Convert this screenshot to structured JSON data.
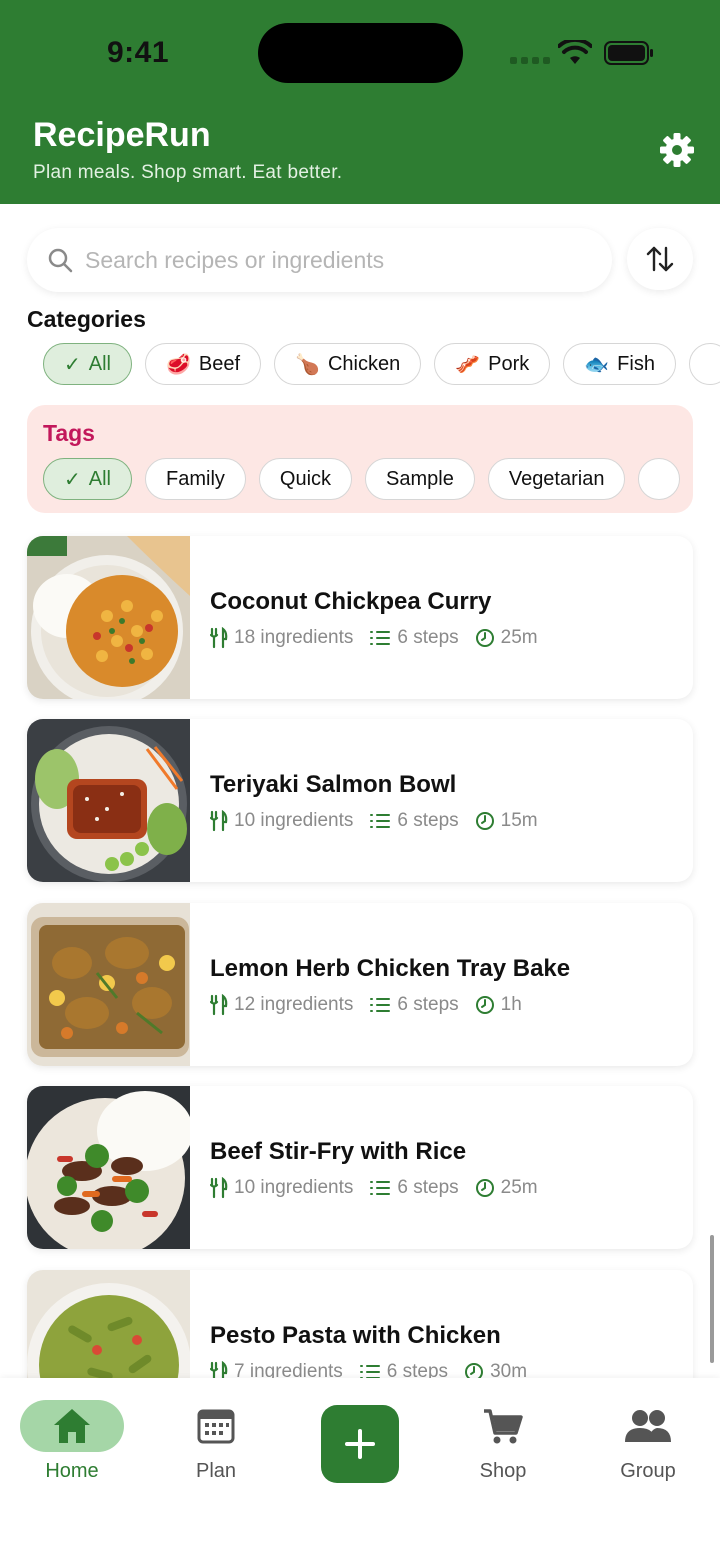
{
  "status_bar": {
    "time": "9:41"
  },
  "header": {
    "title": "RecipeRun",
    "subtitle": "Plan meals. Shop smart. Eat better.",
    "settings_icon": "gear-icon",
    "bg_color": "#2e7d32"
  },
  "search": {
    "placeholder": "Search recipes or ingredients",
    "value": ""
  },
  "categories": {
    "title": "Categories",
    "items": [
      {
        "label": "All",
        "emoji": "",
        "active": true
      },
      {
        "label": "Beef",
        "emoji": "🥩"
      },
      {
        "label": "Chicken",
        "emoji": "🍗"
      },
      {
        "label": "Pork",
        "emoji": "🥓"
      },
      {
        "label": "Fish",
        "emoji": "🐟"
      }
    ]
  },
  "tags": {
    "title": "Tags",
    "items": [
      {
        "label": "All",
        "active": true
      },
      {
        "label": "Family"
      },
      {
        "label": "Quick"
      },
      {
        "label": "Sample"
      },
      {
        "label": "Vegetarian"
      }
    ]
  },
  "recipes": [
    {
      "name": "Coconut Chickpea Curry",
      "ingredients": "18 ingredients",
      "steps": "6 steps",
      "time": "25m"
    },
    {
      "name": "Teriyaki Salmon Bowl",
      "ingredients": "10 ingredients",
      "steps": "6 steps",
      "time": "15m"
    },
    {
      "name": "Lemon Herb Chicken Tray Bake",
      "ingredients": "12 ingredients",
      "steps": "6 steps",
      "time": "1h"
    },
    {
      "name": "Beef Stir-Fry with Rice",
      "ingredients": "10 ingredients",
      "steps": "6 steps",
      "time": "25m"
    },
    {
      "name": "Pesto Pasta with Chicken",
      "ingredients": "7 ingredients",
      "steps": "6 steps",
      "time": "30m"
    }
  ],
  "tabbar": {
    "items": [
      {
        "label": "Home",
        "icon": "home-icon",
        "active": true
      },
      {
        "label": "Plan",
        "icon": "calendar-icon"
      },
      {
        "label": "",
        "icon": "plus-icon"
      },
      {
        "label": "Shop",
        "icon": "cart-icon"
      },
      {
        "label": "Group",
        "icon": "group-icon"
      }
    ]
  },
  "colors": {
    "accent": "#2e7d32",
    "tags_bg": "#fde7e4",
    "tags_title": "#c2185b"
  }
}
